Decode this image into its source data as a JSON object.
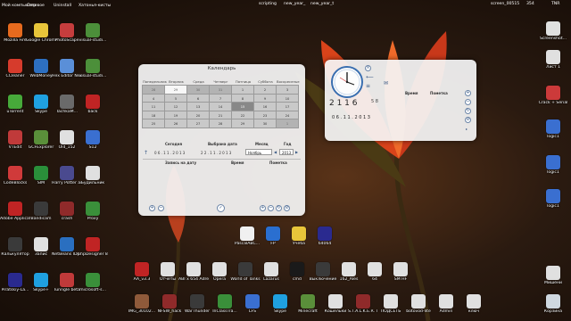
{
  "top_labels": [
    "Мой компьютер",
    "Сетевое",
    "Uninstall",
    "Хатонья-кисты",
    "Алмостье",
    "Спрашивет",
    "scripting",
    "new_year_",
    "new_year_t",
    "",
    "",
    "screen_00515",
    "354",
    "TNR"
  ],
  "desktop_left": [
    {
      "label": "Mozilla Fire",
      "color": "#e66a1e"
    },
    {
      "label": "Google Chrome",
      "color": "#e8c53a"
    },
    {
      "label": "PhotoScape",
      "color": "#c53d3d"
    },
    {
      "label": "visual-studi...",
      "color": "#4c8f3a"
    },
    {
      "label": "CCleaner",
      "color": "#d63b2c"
    },
    {
      "label": "WebMoney",
      "color": "#2d6fc0"
    },
    {
      "label": "Hex Editor Neo",
      "color": "#5a8fd8"
    },
    {
      "label": "visual-studi...",
      "color": "#4c8f3a"
    },
    {
      "label": "uTorrent",
      "color": "#47a93a"
    },
    {
      "label": "Skype",
      "color": "#1fa0e0"
    },
    {
      "label": "TachkaM...",
      "color": "#6a6a6a"
    },
    {
      "label": "back",
      "color": "#c02424"
    },
    {
      "label": "VTEdit",
      "color": "#c03a3a"
    },
    {
      "label": "GCFExplorer",
      "color": "#5a8f3a"
    },
    {
      "label": "Old_152",
      "color": "#e0e0e0"
    },
    {
      "label": "S12",
      "color": "#3a6fd0"
    },
    {
      "label": "CodeBlocks",
      "color": "#d03a3a"
    },
    {
      "label": "SIM",
      "color": "#2a8f3a"
    },
    {
      "label": "Harry Potter and the P...",
      "color": "#4a4a8f"
    },
    {
      "label": "Будильник",
      "color": "#e0e0e0"
    },
    {
      "label": "Adobe Applicati...",
      "color": "#c02424"
    },
    {
      "label": "Bandicam",
      "color": "#3a3a3a"
    },
    {
      "label": "crash",
      "color": "#8f2a2a"
    },
    {
      "label": "Proxy",
      "color": "#3a8f3a"
    },
    {
      "label": "Калькулятор",
      "color": "#3a3a3a"
    },
    {
      "label": "Запис",
      "color": "#e0e0e0"
    },
    {
      "label": "NetBeans IDE 7.3.1",
      "color": "#2a6fc0"
    },
    {
      "label": "phpDesigner 8",
      "color": "#c02424"
    },
    {
      "label": "Piratskiy-La...",
      "color": "#2a2a8f"
    },
    {
      "label": "Skype+",
      "color": "#1fa0e0"
    },
    {
      "label": "Tunngle beta",
      "color": "#c03a3a"
    },
    {
      "label": "microsoft-s...",
      "color": "#3a8f3a"
    }
  ],
  "desktop_right": [
    {
      "label": "Screenshot...",
      "color": "#e0e0e0"
    },
    {
      "label": "Лист 1",
      "color": "#e0e0e0"
    },
    {
      "label": "Crack + Serial",
      "color": "#cc3a3a"
    },
    {
      "label": "logic1",
      "color": "#3a6fd0"
    },
    {
      "label": "logic1",
      "color": "#3a6fd0"
    },
    {
      "label": "logic1",
      "color": "#3a6fd0"
    },
    {
      "label": "Мишени",
      "color": "#e0e0e0"
    },
    {
      "label": "Корзина",
      "color": "#cfd8e0"
    }
  ],
  "desktop_bottom": [
    {
      "label": "AA_v3.3",
      "color": "#c02424"
    },
    {
      "label": "Отчеты",
      "color": "#e0e0e0"
    },
    {
      "label": "ABI x 654 Adreno 203",
      "color": "#e0e0e0"
    },
    {
      "label": "Opera",
      "color": "#e0e0e0"
    },
    {
      "label": "World of Tanks",
      "color": "#3a3a3a"
    },
    {
      "label": "Lazarus",
      "color": "#e0e0e0"
    },
    {
      "label": "cmd",
      "color": "#1a1a1a"
    },
    {
      "label": "Выключение",
      "color": "#3a3a3a"
    },
    {
      "label": "162_Ales",
      "color": "#e0e0e0"
    },
    {
      "label": "64",
      "color": "#e0e0e0"
    },
    {
      "label": "SM HF",
      "color": "#e0e0e0"
    }
  ],
  "desktop_bottom2": [
    {
      "label": "IMG_30102...",
      "color": "#8f5a3a"
    },
    {
      "label": "NFSW_hack",
      "color": "#8f2a2a"
    },
    {
      "label": "WarThunder",
      "color": "#3a3a3a"
    },
    {
      "label": "InClassTra...",
      "color": "#3a8f3a"
    },
    {
      "label": "LFS",
      "color": "#3a6fd0"
    },
    {
      "label": "Skype",
      "color": "#1fa0e0"
    },
    {
      "label": "Minecraft",
      "color": "#5a8f3a"
    },
    {
      "label": "Кошельки",
      "color": "#e0e0e0"
    },
    {
      "label": "S.T.A.L.K.E.R. Тень Чер...",
      "color": "#8f2a2a"
    },
    {
      "label": "ПОДСЕТЬ",
      "color": "#e0e0e0"
    },
    {
      "label": "botovod-lite",
      "color": "#e0e0e0"
    },
    {
      "label": "Admin",
      "color": "#e0e0e0"
    },
    {
      "label": "ключ",
      "color": "#e0e0e0"
    }
  ],
  "desktop_center": [
    {
      "label": "PascalABC...",
      "color": "#f0f0f0"
    },
    {
      "label": "FP",
      "color": "#2a6fd0"
    },
    {
      "label": "Учеба",
      "color": "#e8c53a"
    },
    {
      "label": "64064",
      "color": "#2a2a8f"
    }
  ],
  "calendar": {
    "title": "Календарь",
    "weekdays": [
      "Понедельник",
      "Вторник",
      "Среда",
      "Четверг",
      "Пятница",
      "Суббота",
      "Воскресенье"
    ],
    "month_label": "Октябрь",
    "next_month_label": "Ноябрь",
    "weeks": [
      [
        "28",
        "29",
        "30",
        "31",
        "1",
        "2",
        "3"
      ],
      [
        "4",
        "5",
        "6",
        "7",
        "8",
        "9",
        "10"
      ],
      [
        "11",
        "12",
        "13",
        "14",
        "15",
        "16",
        "17"
      ],
      [
        "18",
        "19",
        "20",
        "21",
        "22",
        "23",
        "24"
      ],
      [
        "25",
        "26",
        "27",
        "28",
        "29",
        "30",
        "1"
      ]
    ],
    "today_label": "Сегодня",
    "selected_label": "Выбрана дата",
    "month_head": "Месяц",
    "year_head": "Год",
    "today_value": "0 6 . 1 1 . 2 0 1 3",
    "selected_value": "2 2 . 1 1 . 2 0 1 3",
    "month_value": "Ноябрь",
    "year_value": "2013",
    "note_header": "Запись на дату",
    "time_header": "Время",
    "mark_header": "Пометка"
  },
  "clock": {
    "time_digits": "2 1 1 6",
    "seconds": "5 8",
    "date": "0 6 . 1 1 . 2 0 1 3",
    "time_col": "Время",
    "mark_col": "Пометка"
  }
}
